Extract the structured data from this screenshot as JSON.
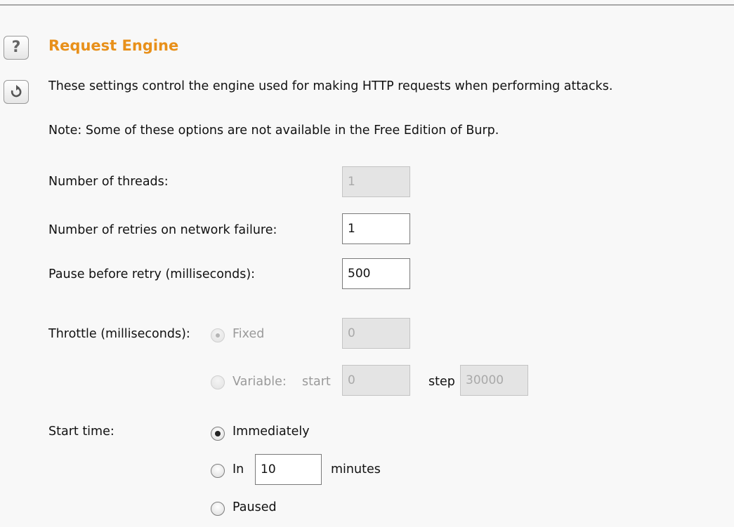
{
  "section": {
    "title": "Request Engine",
    "description": "These settings control the engine used for making HTTP requests when performing attacks.",
    "note": "Note: Some of these options are not available in the Free Edition of Burp."
  },
  "icons": {
    "help": "?",
    "reset": "reset-icon"
  },
  "threads": {
    "label": "Number of threads:",
    "value": "1"
  },
  "retries": {
    "label": "Number of retries on network failure:",
    "value": "1"
  },
  "pause": {
    "label": "Pause before retry (milliseconds):",
    "value": "500"
  },
  "throttle": {
    "label": "Throttle (milliseconds):",
    "fixed_label": "Fixed",
    "fixed_value": "0",
    "variable_label": "Variable:",
    "start_label": "start",
    "start_value": "0",
    "step_label": "step",
    "step_value": "30000"
  },
  "start_time": {
    "label": "Start time:",
    "immediately_label": "Immediately",
    "in_label": "In",
    "in_value": "10",
    "minutes_label": "minutes",
    "paused_label": "Paused"
  },
  "colors": {
    "title": "#e8901a"
  }
}
